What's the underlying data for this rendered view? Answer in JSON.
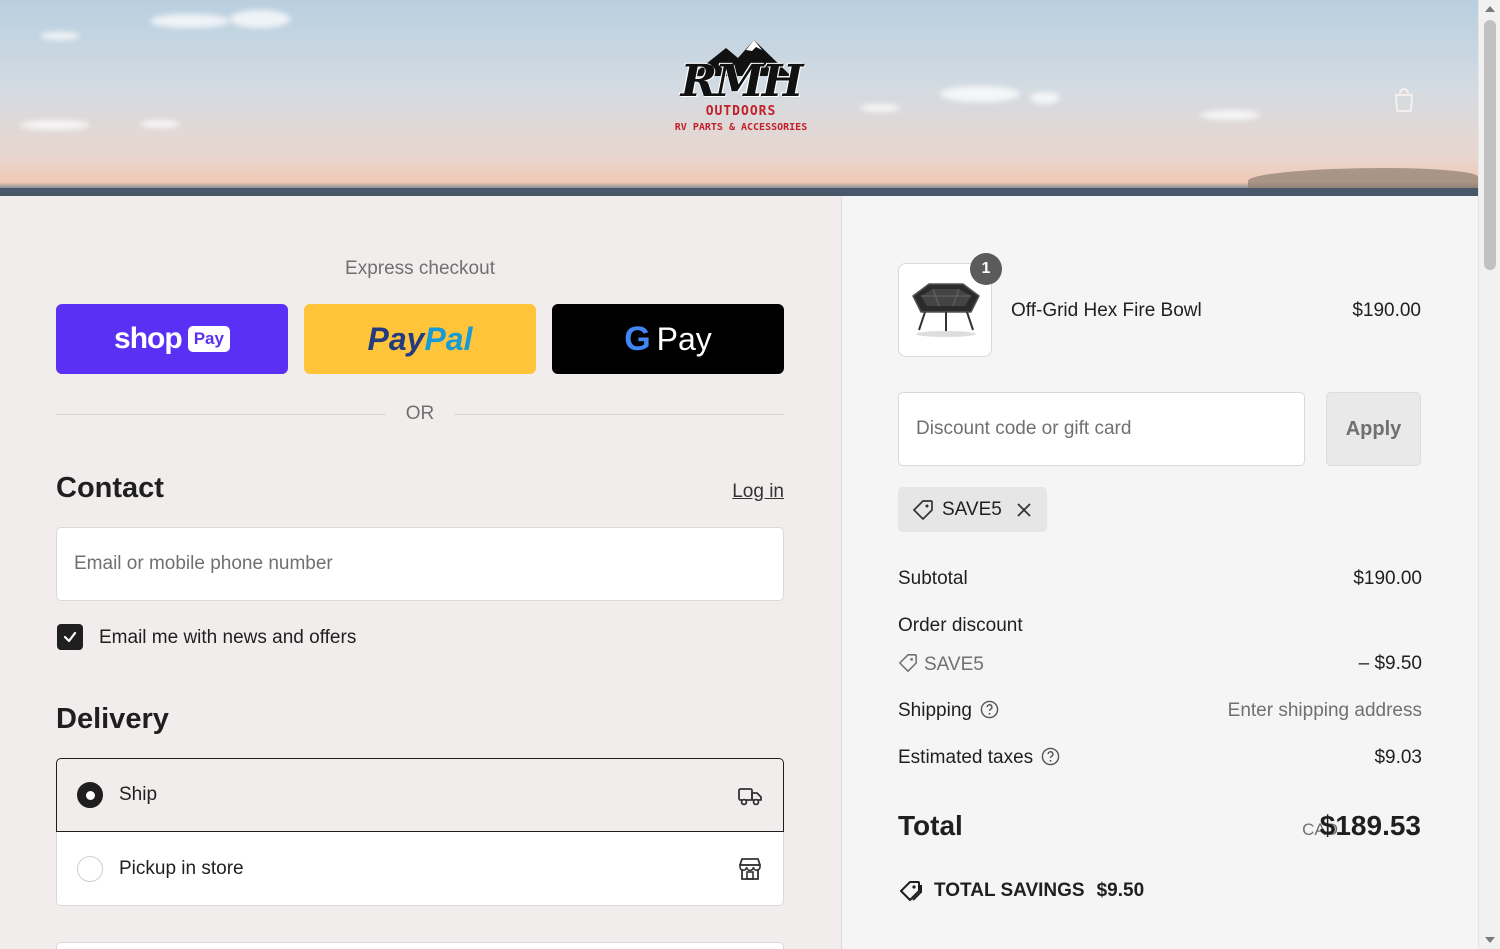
{
  "header": {
    "logo_main": "RMH",
    "logo_line1": "OUTDOORS",
    "logo_line2": "RV PARTS & ACCESSORIES",
    "cart_icon": "shopping-bag-icon"
  },
  "express": {
    "title": "Express checkout",
    "shop_pay": {
      "word": "shop",
      "badge": "Pay"
    },
    "paypal": {
      "part1": "Pay",
      "part2": "Pal"
    },
    "gpay": {
      "g": "G",
      "word": "Pay"
    },
    "or_text": "OR"
  },
  "contact": {
    "heading": "Contact",
    "login_link": "Log in",
    "email_placeholder": "Email or mobile phone number",
    "newsletter_label": "Email me with news and offers",
    "newsletter_checked": true
  },
  "delivery": {
    "heading": "Delivery",
    "options": [
      {
        "label": "Ship",
        "selected": true,
        "icon": "truck-icon"
      },
      {
        "label": "Pickup in store",
        "selected": false,
        "icon": "store-icon"
      }
    ]
  },
  "summary": {
    "item": {
      "name": "Off-Grid Hex Fire Bowl",
      "price": "$190.00",
      "quantity": "1"
    },
    "discount_placeholder": "Discount code or gift card",
    "apply_label": "Apply",
    "applied_code": "SAVE5",
    "subtotal_label": "Subtotal",
    "subtotal_value": "$190.00",
    "order_discount_label": "Order discount",
    "order_discount_code": "SAVE5",
    "order_discount_value": "– $9.50",
    "shipping_label": "Shipping",
    "shipping_value": "Enter shipping address",
    "taxes_label": "Estimated taxes",
    "taxes_value": "$9.03",
    "total_label": "Total",
    "total_currency": "CAD",
    "total_value": "$189.53",
    "savings_label": "TOTAL SAVINGS",
    "savings_value": "$9.50"
  },
  "colors": {
    "shop_pay": "#5a31f4",
    "paypal": "#ffc439",
    "gpay": "#000000",
    "logo_red": "#c2202a"
  }
}
